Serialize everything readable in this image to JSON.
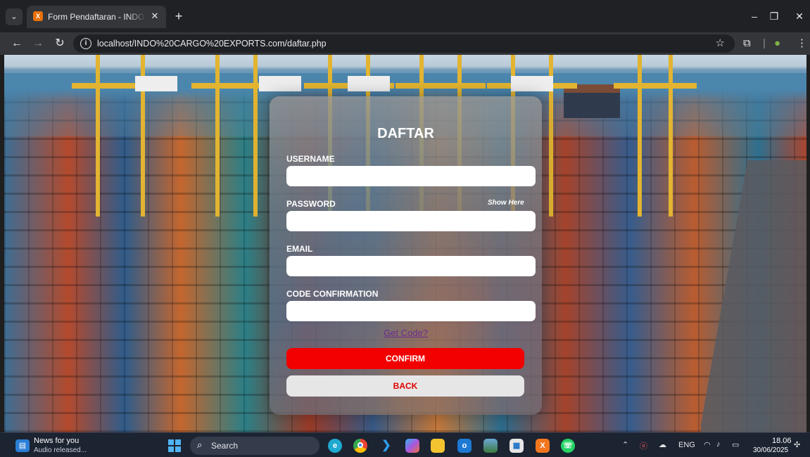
{
  "browser": {
    "tab_title": "Form Pendaftaran - INDO CARGO EXPORTS",
    "tab_favicon": "X",
    "new_tab": "+",
    "url": "localhost/INDO%20CARGO%20EXPORTS.com/daftar.php"
  },
  "form": {
    "title": "DAFTAR",
    "username_label": "USERNAME",
    "password_label": "PASSWORD",
    "show_password": "Show Here",
    "email_label": "EMAIL",
    "code_label": "CODE CONFIRMATION",
    "get_code_link": "Get Code?",
    "confirm_button": "CONFIRM",
    "back_button": "BACK",
    "username_value": "",
    "password_value": "",
    "email_value": "",
    "code_value": ""
  },
  "taskbar": {
    "news_title": "News for you",
    "news_subtitle": "Audio released...",
    "search_placeholder": "Search",
    "language": "ENG",
    "time": "18.06",
    "date": "30/06/2025",
    "icons": [
      "edge-icon",
      "chrome-icon",
      "vscode-icon",
      "copilot-icon",
      "file-explorer-icon",
      "outlook-icon",
      "photos-icon",
      "store-icon",
      "xampp-icon",
      "whatsapp-icon"
    ]
  },
  "colors": {
    "confirm_bg": "#f20000",
    "back_bg": "#e6e6e6",
    "back_text": "#e00000",
    "link": "#6b2d8c",
    "crane": "#e2b431"
  }
}
